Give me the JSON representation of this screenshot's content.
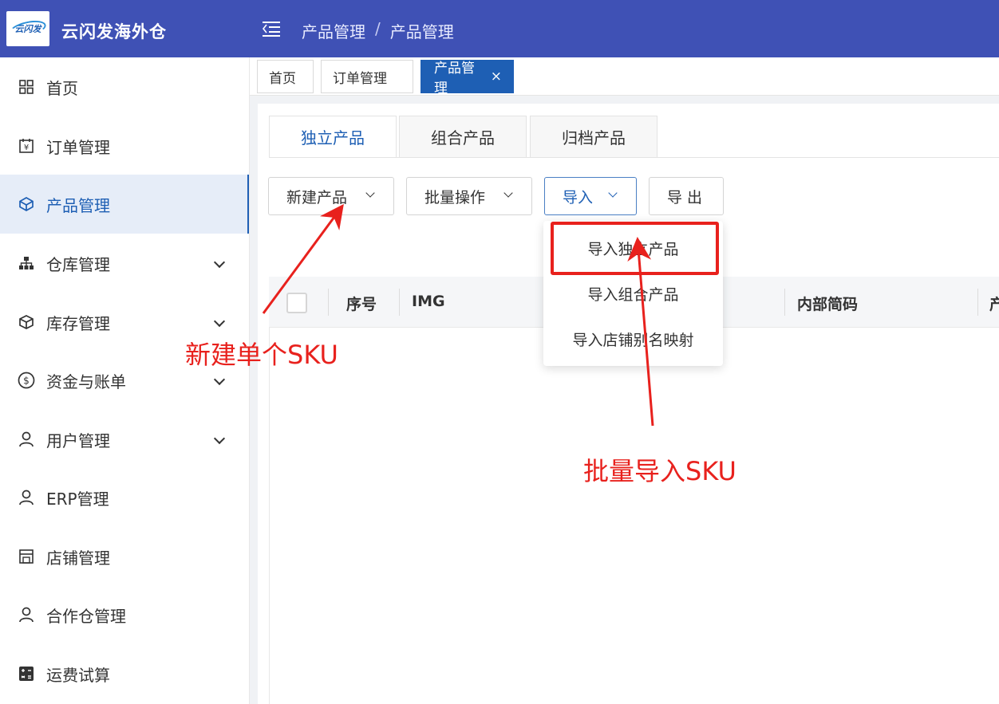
{
  "app": {
    "brand_name": "云闪发海外仓",
    "logo_text": "云闪发"
  },
  "header": {
    "breadcrumb": [
      "产品管理",
      "产品管理"
    ],
    "breadcrumb_sep": "/"
  },
  "sidebar": {
    "items": [
      {
        "label": "首页",
        "icon": "grid-icon",
        "expandable": false,
        "active": false
      },
      {
        "label": "订单管理",
        "icon": "calendar-yen-icon",
        "expandable": false,
        "active": false
      },
      {
        "label": "产品管理",
        "icon": "cube-outline-icon",
        "expandable": false,
        "active": true
      },
      {
        "label": "仓库管理",
        "icon": "hierarchy-icon",
        "expandable": true,
        "active": false
      },
      {
        "label": "库存管理",
        "icon": "box-icon",
        "expandable": true,
        "active": false
      },
      {
        "label": "资金与账单",
        "icon": "dollar-circle-icon",
        "expandable": true,
        "active": false
      },
      {
        "label": "用户管理",
        "icon": "user-icon",
        "expandable": true,
        "active": false
      },
      {
        "label": "ERP管理",
        "icon": "user-icon",
        "expandable": false,
        "active": false
      },
      {
        "label": "店铺管理",
        "icon": "store-icon",
        "expandable": false,
        "active": false
      },
      {
        "label": "合作仓管理",
        "icon": "user-icon",
        "expandable": false,
        "active": false
      },
      {
        "label": "运费试算",
        "icon": "calculator-icon",
        "expandable": false,
        "active": false
      }
    ]
  },
  "page_tabs": [
    {
      "label": "首页",
      "active": false
    },
    {
      "label": "订单管理",
      "active": false
    },
    {
      "label": "产品管理",
      "active": true,
      "close": "×"
    }
  ],
  "product_tabs": [
    {
      "label": "独立产品",
      "active": true
    },
    {
      "label": "组合产品",
      "active": false
    },
    {
      "label": "归档产品",
      "active": false
    }
  ],
  "toolbar": {
    "new_product": "新建产品",
    "batch_ops": "批量操作",
    "import": "导入",
    "export": "导 出"
  },
  "import_menu": {
    "items": [
      "导入独立产品",
      "导入组合产品",
      "导入店铺别名映射"
    ],
    "highlighted_index": 0
  },
  "table": {
    "columns": [
      "序号",
      "IMG",
      "内部简码",
      "产"
    ]
  },
  "annotations": {
    "new_single_sku": "新建单个SKU",
    "batch_import_sku": "批量导入SKU",
    "color": "#e8211d"
  },
  "colors": {
    "header_bg": "#3f51b5",
    "primary": "#1e5fb4",
    "annotation_red": "#e8211d"
  }
}
